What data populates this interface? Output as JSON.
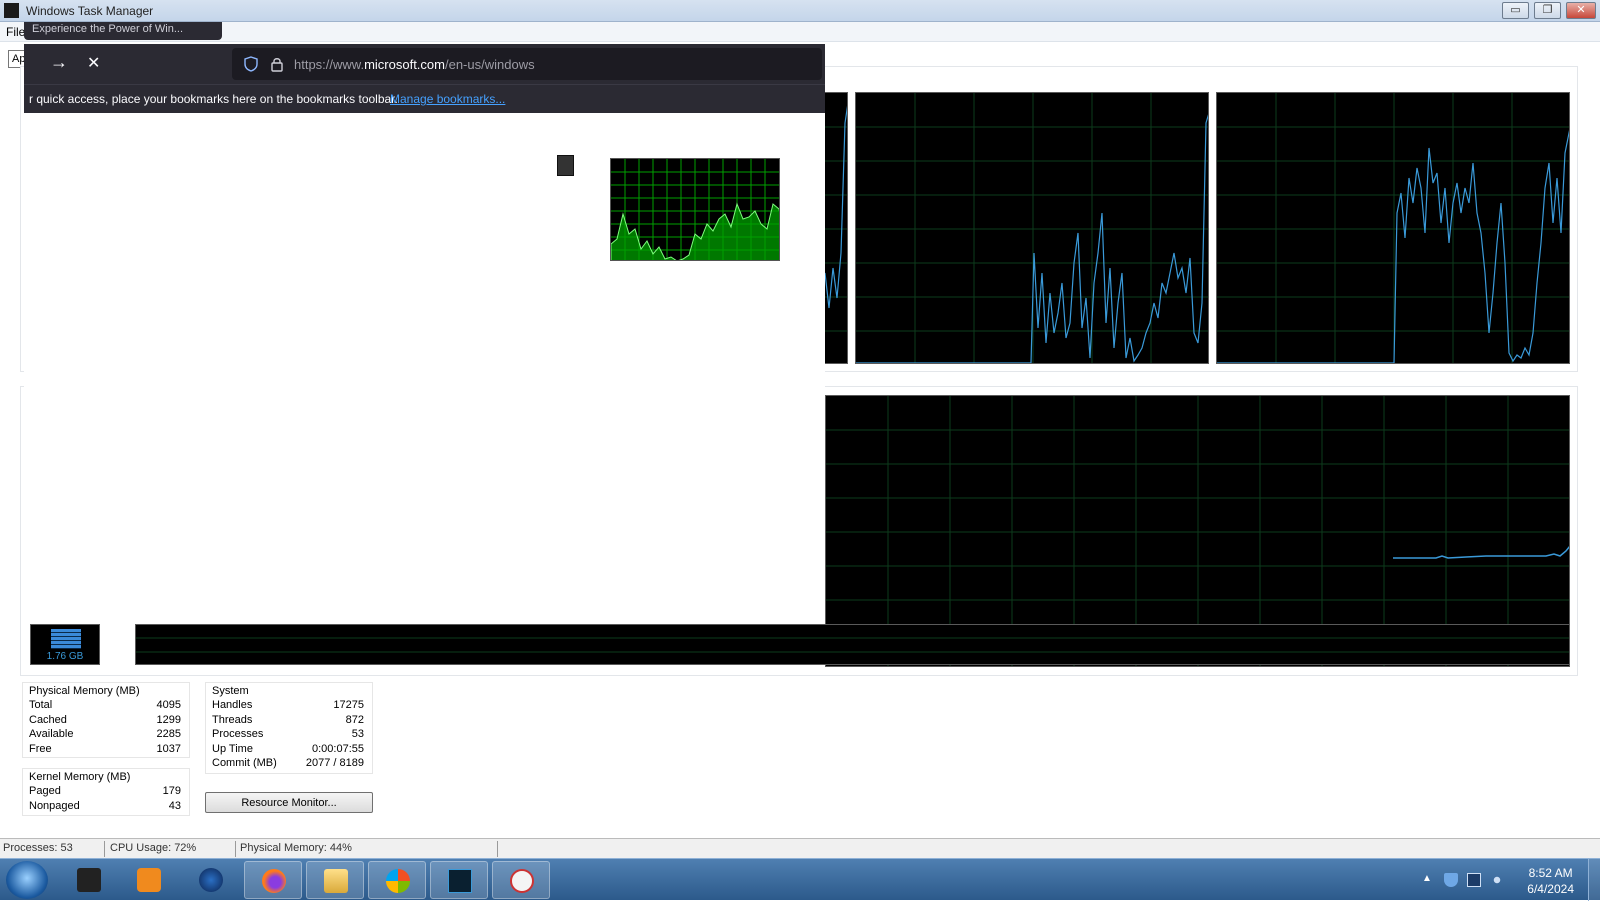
{
  "window": {
    "title": "Windows Task Manager"
  },
  "menu": {
    "file_label": "File"
  },
  "tabs": {
    "first_tab_stub": "Ap"
  },
  "firefox": {
    "tab_title_remnant": "Experience the Power of Win...",
    "url_prefix": "https://www.",
    "url_domain": "microsoft.com",
    "url_path": "/en-us/windows",
    "bookmarks_text": "r quick access, place your bookmarks here on the bookmarks toolbar.",
    "manage_bookmarks": "Manage bookmarks..."
  },
  "memory_meter": {
    "value": "1.76 GB"
  },
  "physical_memory": {
    "title": "Physical Memory (MB)",
    "rows": [
      {
        "label": "Total",
        "value": "4095"
      },
      {
        "label": "Cached",
        "value": "1299"
      },
      {
        "label": "Available",
        "value": "2285"
      },
      {
        "label": "Free",
        "value": "1037"
      }
    ]
  },
  "kernel_memory": {
    "title": "Kernel Memory (MB)",
    "rows": [
      {
        "label": "Paged",
        "value": "179"
      },
      {
        "label": "Nonpaged",
        "value": "43"
      }
    ]
  },
  "system": {
    "title": "System",
    "rows": [
      {
        "label": "Handles",
        "value": "17275"
      },
      {
        "label": "Threads",
        "value": "872"
      },
      {
        "label": "Processes",
        "value": "53"
      },
      {
        "label": "Up Time",
        "value": "0:00:07:55"
      },
      {
        "label": "Commit (MB)",
        "value": "2077 / 8189"
      }
    ]
  },
  "buttons": {
    "resource_monitor": "Resource Monitor..."
  },
  "statusbar": {
    "processes": "Processes: 53",
    "cpu": "CPU Usage: 72%",
    "memory": "Physical Memory: 44%"
  },
  "taskbar": {
    "time": "8:52 AM",
    "date": "6/4/2024",
    "apps": [
      "start-orb",
      "terminal",
      "media-player",
      "globe",
      "firefox",
      "file-explorer",
      "windows-logo",
      "task-manager",
      "clock-app"
    ]
  },
  "colors": {
    "graph_grid": "#0d3b1c",
    "graph_line": "#3a9ad9",
    "cpu_meter_fill": "#00a000",
    "firefox_dark": "#2b2a33",
    "link": "#45a1ff"
  }
}
